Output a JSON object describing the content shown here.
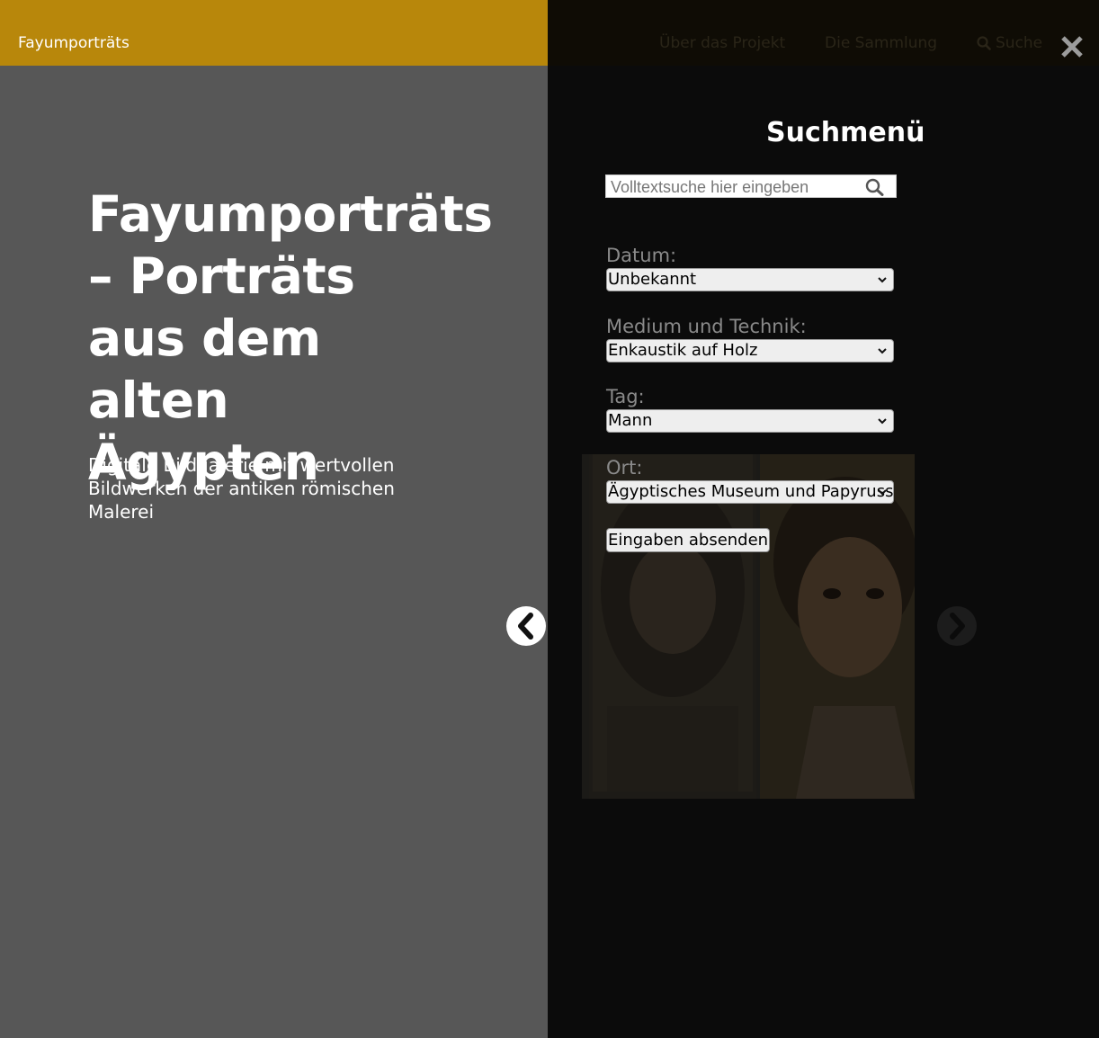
{
  "header": {
    "brand": "Fayumporträts",
    "nav": {
      "about": "Über das Projekt",
      "collection": "Die Sammlung",
      "search": "Suche"
    }
  },
  "hero": {
    "title": "Fayumporträts – Porträts aus dem alten Ägypten",
    "subtitle": "Digitale Bildgalerie mit wertvollen Bildwerken der antiken römischen Malerei"
  },
  "search_menu": {
    "heading": "Suchmenü",
    "fulltext_placeholder": "Volltextsuche hier eingeben",
    "fields": {
      "date": {
        "label": "Datum:",
        "value": "Unbekannt"
      },
      "medium": {
        "label": "Medium und Technik:",
        "value": "Enkaustik auf Holz"
      },
      "tag": {
        "label": "Tag:",
        "value": "Mann"
      },
      "place": {
        "label": "Ort:",
        "value": "Ägyptisches Museum und Papyrussa"
      }
    },
    "submit": "Eingaben absenden"
  },
  "icons": {
    "close": "close-icon",
    "prev": "chevron-left-icon",
    "next": "chevron-right-icon",
    "search": "search-icon"
  },
  "colors": {
    "brand_bar": "#b8870b",
    "left_panel": "#575757",
    "overlay": "#0b0b0b"
  }
}
